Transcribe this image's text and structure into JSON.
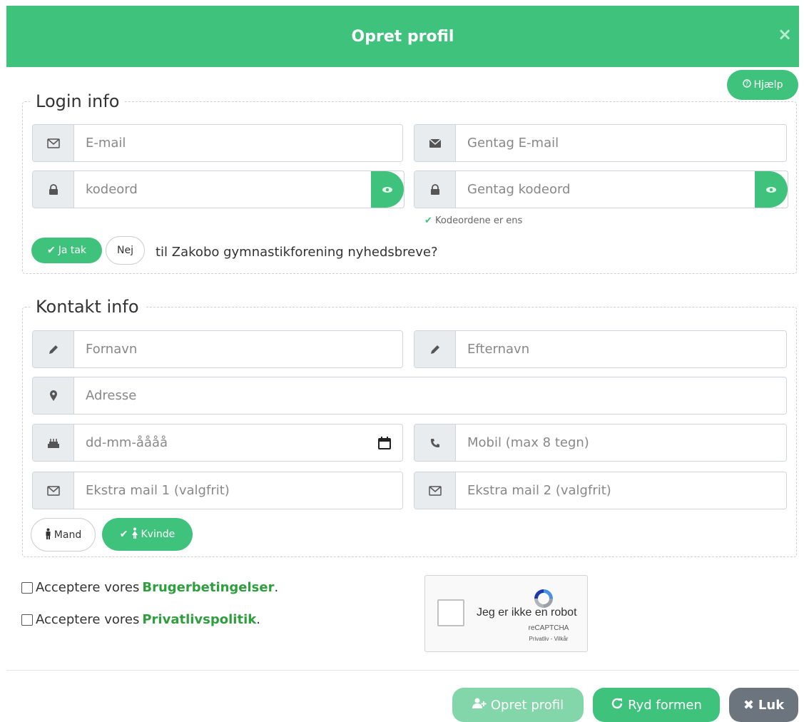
{
  "header": {
    "title": "Opret profil",
    "close_glyph": "×"
  },
  "help_button": {
    "label": "Hjælp",
    "icon": "question-circle-icon"
  },
  "login": {
    "legend": "Login info",
    "email_placeholder": "E-mail",
    "repeat_email_placeholder": "Gentag E-mail",
    "password_placeholder": "kodeord",
    "repeat_password_placeholder": "Gentag kodeord",
    "match_message": "Kodeordene er ens",
    "newsletter_yes": "Ja tak",
    "newsletter_no": "Nej",
    "newsletter_text": "til Zakobo gymnastikforening nyhedsbreve?"
  },
  "contact": {
    "legend": "Kontakt info",
    "firstname_placeholder": "Fornavn",
    "lastname_placeholder": "Efternavn",
    "address_placeholder": "Adresse",
    "birthdate_placeholder": "dd-mm-åååå",
    "mobile_placeholder": "Mobil (max 8 tegn)",
    "extra_mail1_placeholder": "Ekstra mail 1 (valgfrit)",
    "extra_mail2_placeholder": "Ekstra mail 2 (valgfrit)",
    "gender_male": "Mand",
    "gender_female": "Kvinde"
  },
  "terms": {
    "accept_prefix": "Acceptere vores",
    "terms_link": "Brugerbetingelser",
    "privacy_link": "Privatlivspolitik",
    "suffix": "."
  },
  "recaptcha": {
    "label": "Jeg er ikke en robot",
    "brand": "reCAPTCHA",
    "links": "Privatliv - Vilkår"
  },
  "footer": {
    "create_label": "Opret profil",
    "reset_label": "Ryd formen",
    "close_label": "Luk"
  },
  "colors": {
    "primary_green": "#3fc27c",
    "link_green": "#2e9e3e",
    "gray_button": "#6c757d"
  }
}
